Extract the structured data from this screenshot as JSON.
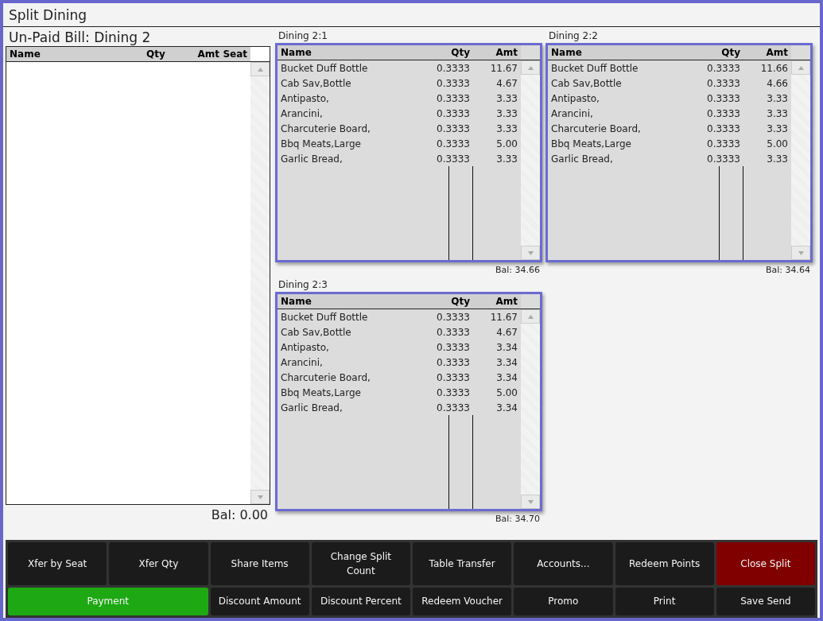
{
  "window": {
    "title": "Split Dining"
  },
  "unpaid_bill": {
    "title": "Un-Paid Bill: Dining 2",
    "columns": [
      "Name",
      "Qty",
      "Amt",
      "Seat"
    ],
    "balance": "Bal: 0.00"
  },
  "splits": [
    {
      "title": "Dining 2:1",
      "columns": [
        "Name",
        "Qty",
        "Amt"
      ],
      "balance": "Bal: 34.66",
      "rows": [
        {
          "name": "Bucket Duff Bottle",
          "qty": "0.3333",
          "amt": "11.67"
        },
        {
          "name": "Cab Sav,Bottle",
          "qty": "0.3333",
          "amt": "4.67"
        },
        {
          "name": "Antipasto,",
          "qty": "0.3333",
          "amt": "3.33"
        },
        {
          "name": "Arancini,",
          "qty": "0.3333",
          "amt": "3.33"
        },
        {
          "name": "Charcuterie Board,",
          "qty": "0.3333",
          "amt": "3.33"
        },
        {
          "name": "Bbq Meats,Large",
          "qty": "0.3333",
          "amt": "5.00"
        },
        {
          "name": "Garlic Bread,",
          "qty": "0.3333",
          "amt": "3.33"
        }
      ]
    },
    {
      "title": "Dining 2:2",
      "columns": [
        "Name",
        "Qty",
        "Amt"
      ],
      "balance": "Bal: 34.64",
      "rows": [
        {
          "name": "Bucket Duff Bottle",
          "qty": "0.3333",
          "amt": "11.66"
        },
        {
          "name": "Cab Sav,Bottle",
          "qty": "0.3333",
          "amt": "4.66"
        },
        {
          "name": "Antipasto,",
          "qty": "0.3333",
          "amt": "3.33"
        },
        {
          "name": "Arancini,",
          "qty": "0.3333",
          "amt": "3.33"
        },
        {
          "name": "Charcuterie Board,",
          "qty": "0.3333",
          "amt": "3.33"
        },
        {
          "name": "Bbq Meats,Large",
          "qty": "0.3333",
          "amt": "5.00"
        },
        {
          "name": "Garlic Bread,",
          "qty": "0.3333",
          "amt": "3.33"
        }
      ]
    },
    {
      "title": "Dining 2:3",
      "columns": [
        "Name",
        "Qty",
        "Amt"
      ],
      "balance": "Bal: 34.70",
      "rows": [
        {
          "name": "Bucket Duff Bottle",
          "qty": "0.3333",
          "amt": "11.67"
        },
        {
          "name": "Cab Sav,Bottle",
          "qty": "0.3333",
          "amt": "4.67"
        },
        {
          "name": "Antipasto,",
          "qty": "0.3333",
          "amt": "3.34"
        },
        {
          "name": "Arancini,",
          "qty": "0.3333",
          "amt": "3.34"
        },
        {
          "name": "Charcuterie Board,",
          "qty": "0.3333",
          "amt": "3.34"
        },
        {
          "name": "Bbq Meats,Large",
          "qty": "0.3333",
          "amt": "5.00"
        },
        {
          "name": "Garlic Bread,",
          "qty": "0.3333",
          "amt": "3.34"
        }
      ]
    }
  ],
  "buttons": [
    {
      "label": "Xfer by Seat",
      "kind": "normal"
    },
    {
      "label": "Xfer Qty",
      "kind": "normal"
    },
    {
      "label": "Share Items",
      "kind": "normal"
    },
    {
      "label": "Change Split Count",
      "kind": "normal"
    },
    {
      "label": "Table Transfer",
      "kind": "normal"
    },
    {
      "label": "Accounts...",
      "kind": "normal"
    },
    {
      "label": "Redeem Points",
      "kind": "normal"
    },
    {
      "label": "Close Split",
      "kind": "danger"
    },
    {
      "label": "Payment",
      "kind": "primary"
    },
    {
      "label": "Discount Amount",
      "kind": "normal"
    },
    {
      "label": "Discount Percent",
      "kind": "normal"
    },
    {
      "label": "Redeem Voucher",
      "kind": "normal"
    },
    {
      "label": "Promo",
      "kind": "normal"
    },
    {
      "label": "Print",
      "kind": "normal"
    },
    {
      "label": "Save Send",
      "kind": "normal"
    }
  ]
}
